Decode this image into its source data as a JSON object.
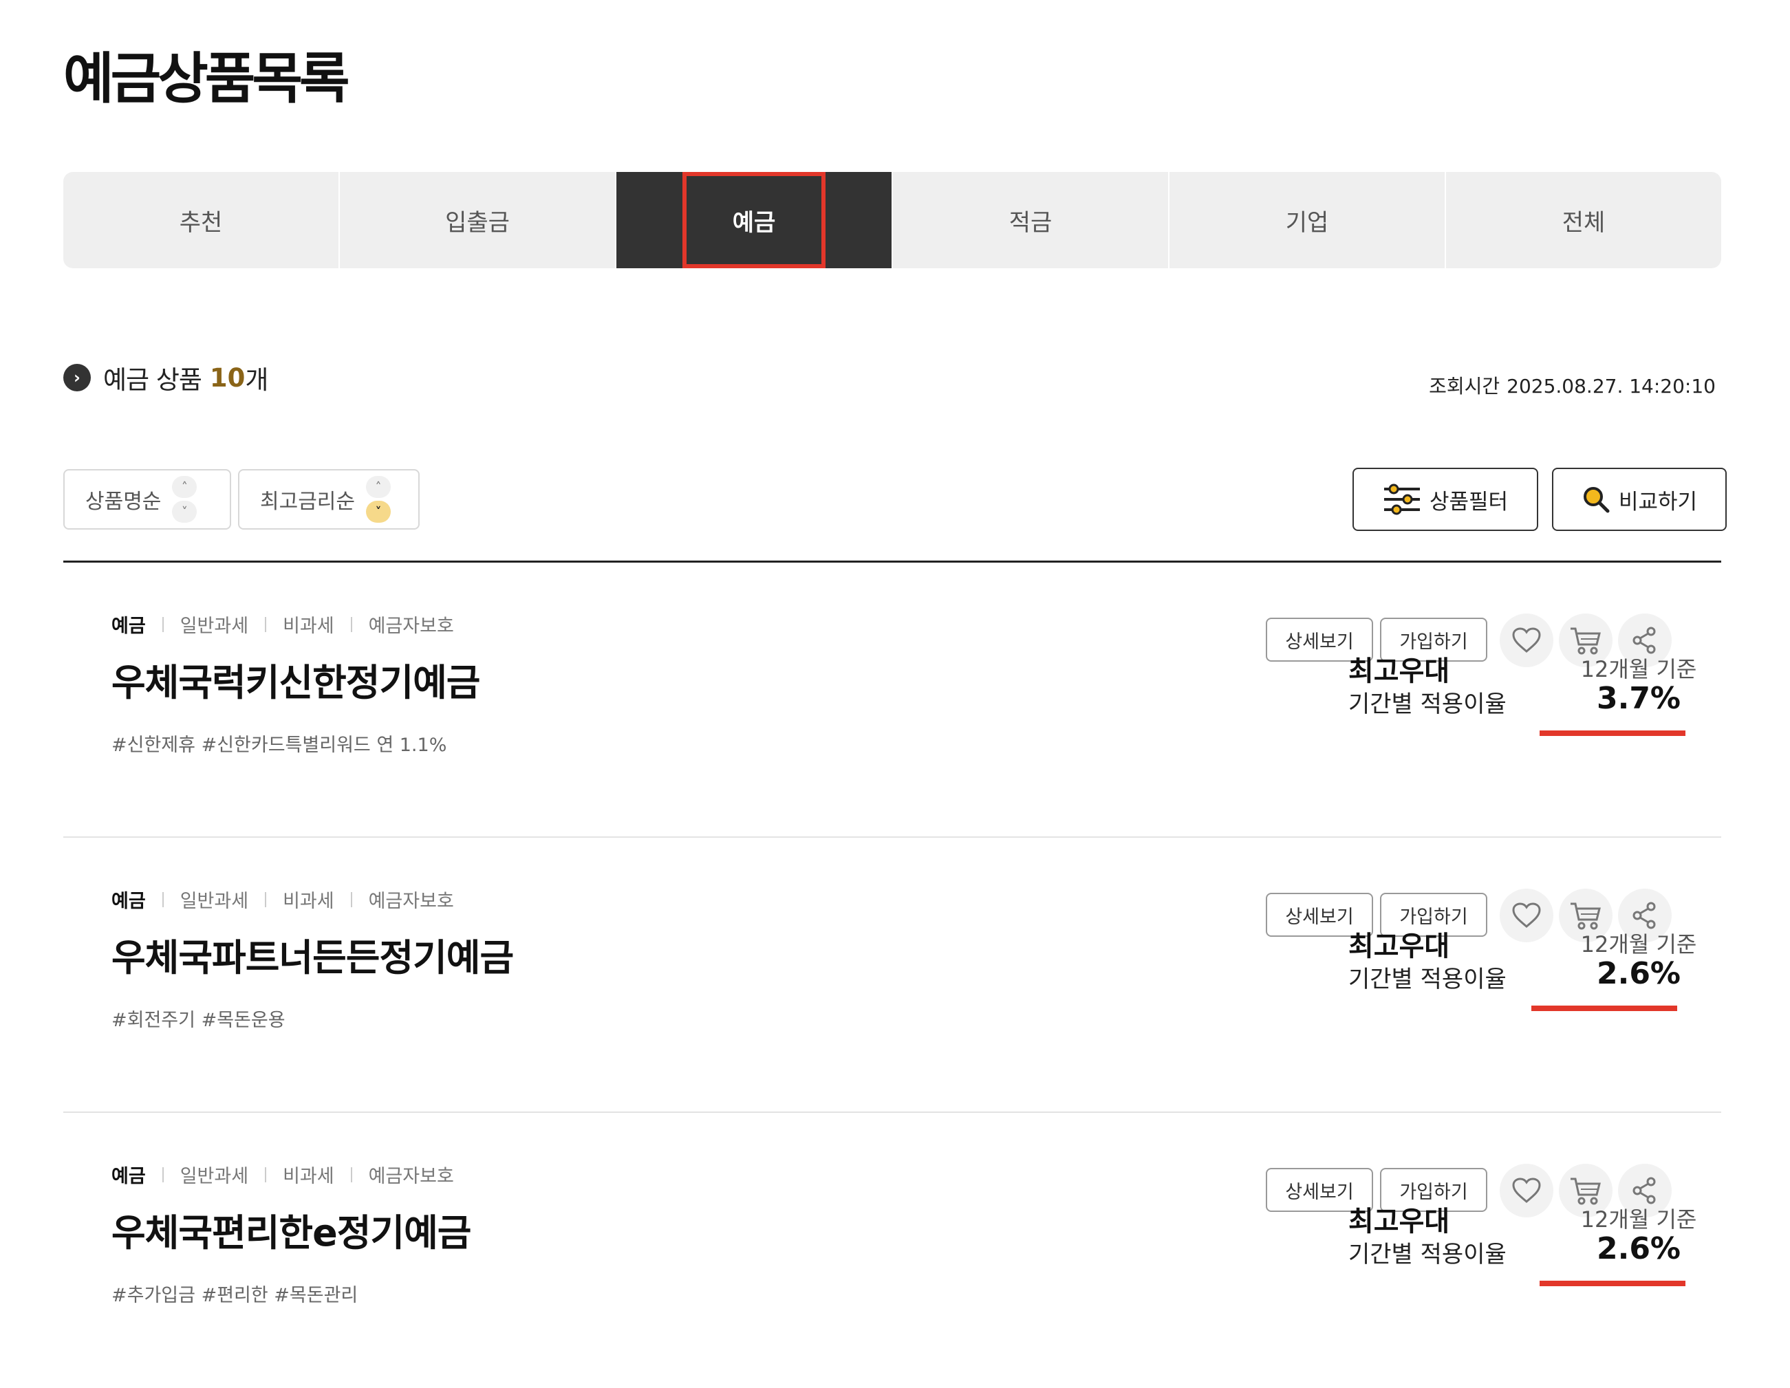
{
  "page_title": "예금상품목록",
  "tabs": [
    {
      "label": "추천",
      "active": false
    },
    {
      "label": "입출금",
      "active": false
    },
    {
      "label": "예금",
      "active": true
    },
    {
      "label": "적금",
      "active": false
    },
    {
      "label": "기업",
      "active": false
    },
    {
      "label": "전체",
      "active": false
    }
  ],
  "summary": {
    "label": "예금 상품",
    "count": "10",
    "unit": "개",
    "lookup_label": "조회시간",
    "lookup_time": "2025.08.27. 14:20:10"
  },
  "sort": [
    {
      "label": "상품명순"
    },
    {
      "label": "최고금리순",
      "selected_direction": "down"
    }
  ],
  "tools": {
    "filter_label": "상품필터",
    "compare_label": "비교하기"
  },
  "products": [
    {
      "tags": [
        "예금",
        "일반과세",
        "비과세",
        "예금자보호"
      ],
      "name": "우체국럭키신한정기예금",
      "hashtags": "#신한제휴 #신한카드특별리워드 연 1.1%",
      "detail_label": "상세보기",
      "join_label": "가입하기",
      "rate_title": "최고우대",
      "rate_sub": "기간별 적용이율",
      "period": "12개월 기준",
      "rate": "3.7%"
    },
    {
      "tags": [
        "예금",
        "일반과세",
        "비과세",
        "예금자보호"
      ],
      "name": "우체국파트너든든정기예금",
      "hashtags": "#회전주기 #목돈운용",
      "detail_label": "상세보기",
      "join_label": "가입하기",
      "rate_title": "최고우대",
      "rate_sub": "기간별 적용이율",
      "period": "12개월 기준",
      "rate": "2.6%"
    },
    {
      "tags": [
        "예금",
        "일반과세",
        "비과세",
        "예금자보호"
      ],
      "name": "우체국편리한e정기예금",
      "hashtags": "#추가입금 #편리한 #목돈관리",
      "detail_label": "상세보기",
      "join_label": "가입하기",
      "rate_title": "최고우대",
      "rate_sub": "기간별 적용이율",
      "period": "12개월 기준",
      "rate": "2.6%"
    }
  ],
  "colors": {
    "accent_red": "#e2372a",
    "active_tab_bg": "#333333",
    "count_gold": "#8a6418",
    "sort_active_yellow": "#f6d98a"
  }
}
